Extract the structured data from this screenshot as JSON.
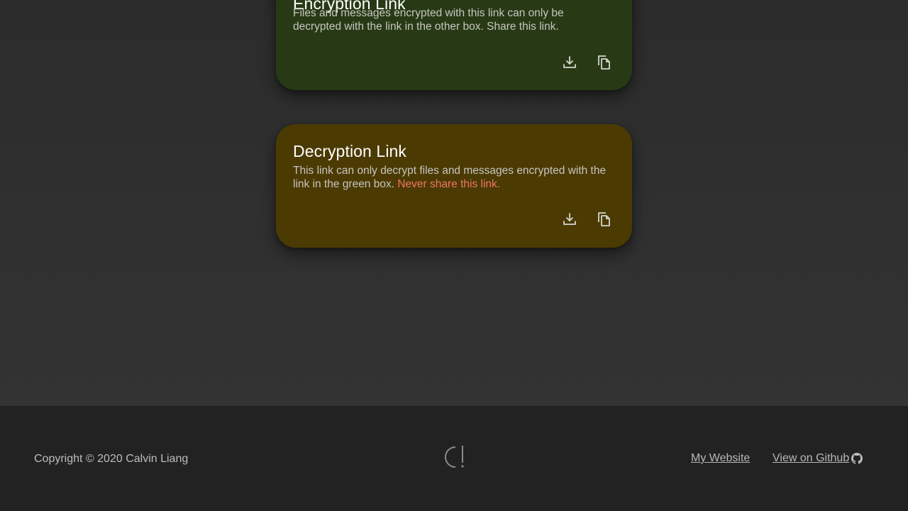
{
  "encryption_card": {
    "title": "Encryption Link",
    "description": "Files and messages encrypted with this link can only be decrypted with the link in the other box. Share this link.",
    "download_icon": "download-icon",
    "copy_icon": "copy-icon",
    "background": "#283a15"
  },
  "decryption_card": {
    "title": "Decryption Link",
    "description": "This link can only decrypt files and messages encrypted with the link in the green box. ",
    "warning": "Never share this link.",
    "download_icon": "download-icon",
    "copy_icon": "copy-icon",
    "background": "#4b3a02",
    "warning_color": "#f07665"
  },
  "footer": {
    "copyright": "Copyright © 2020 Calvin Liang",
    "logo_icon": "app-logo-icon",
    "links": {
      "website": "My Website",
      "github": "View on Github "
    },
    "github_icon": "github-icon"
  }
}
